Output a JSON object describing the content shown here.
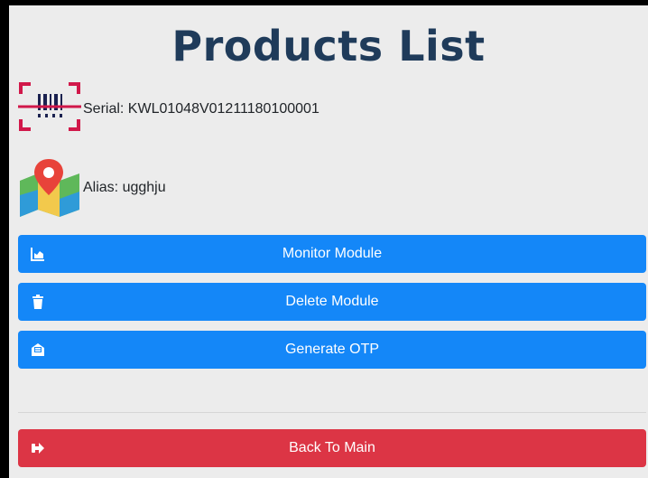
{
  "page": {
    "title": "Products List"
  },
  "serial": {
    "text": "Serial: KWL01048V01211180100001",
    "icon": "barcode-scanner-icon"
  },
  "alias": {
    "text": "Alias: ugghju",
    "icon": "map-pin-icon"
  },
  "buttons": {
    "monitor": "Monitor Module",
    "delete": "Delete Module",
    "otp": "Generate OTP",
    "back": "Back To Main"
  },
  "colors": {
    "primary": "#1487f8",
    "danger": "#dc3545",
    "title": "#1f3b5a",
    "background": "#ececec"
  }
}
